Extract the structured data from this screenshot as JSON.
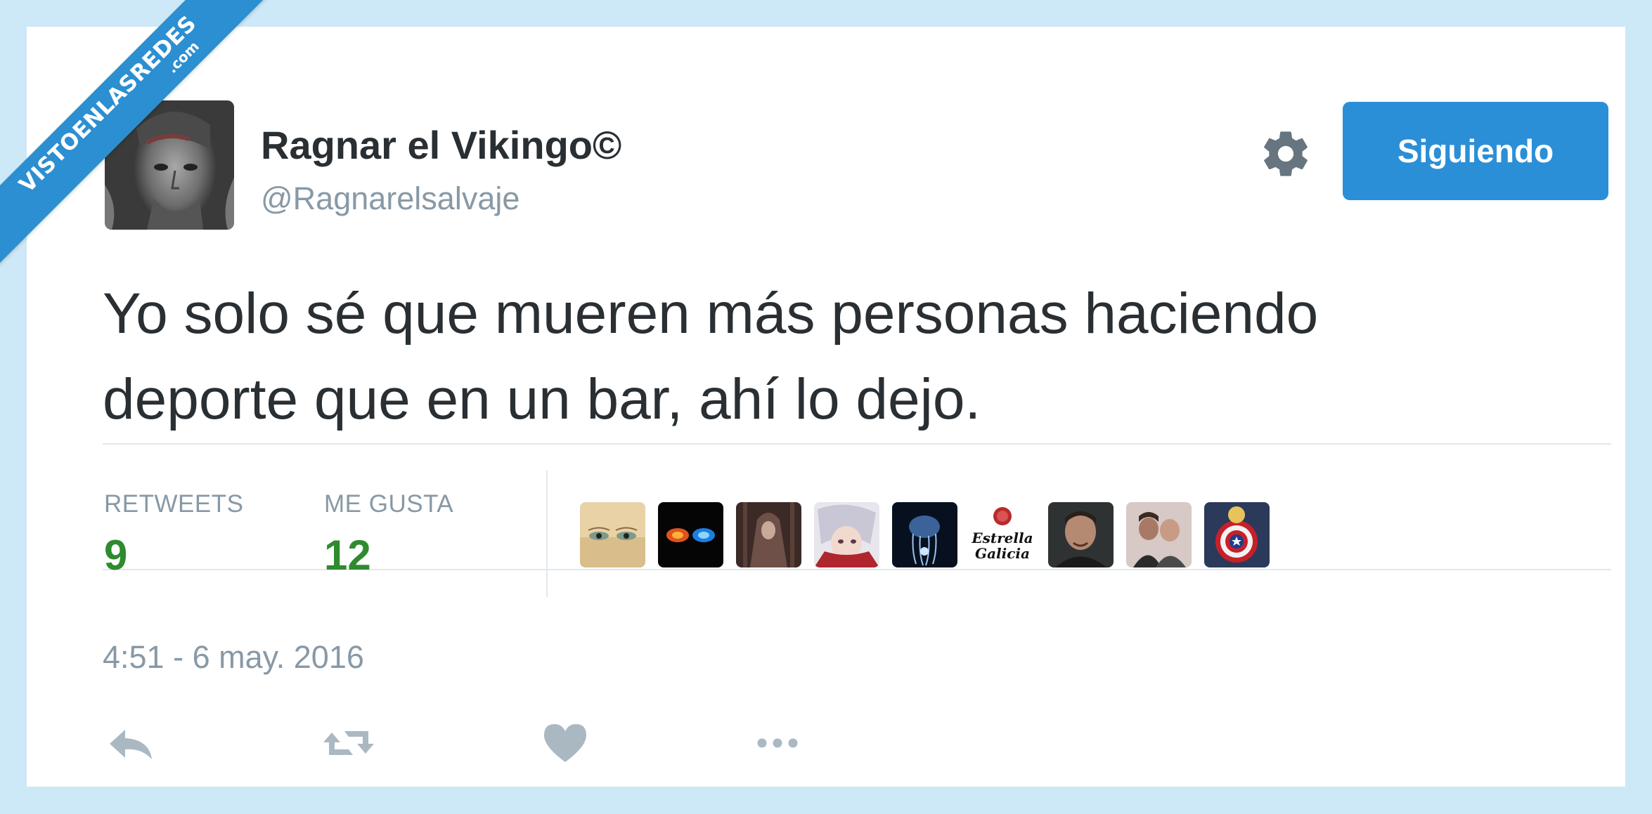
{
  "watermark": {
    "text": "VISTOENLASREDES",
    "sub": ".com"
  },
  "tweet": {
    "display_name": "Ragnar el Vikingo©",
    "handle": "@Ragnarelsalvaje",
    "follow_button": "Siguiendo",
    "text_lines": [
      "Yo solo sé que mueren más personas haciendo",
      "deporte que en un bar, ahí lo dejo."
    ],
    "stats": {
      "retweets_label": "RETWEETS",
      "retweets_value": "9",
      "likes_label": "ME GUSTA",
      "likes_value": "12"
    },
    "likers": [
      {
        "icon": "face-eyes-avatar"
      },
      {
        "icon": "fire-ice-avatar"
      },
      {
        "icon": "hooded-figure-avatar"
      },
      {
        "icon": "anime-character-avatar"
      },
      {
        "icon": "jellyfish-avatar"
      },
      {
        "icon": "estrella-galicia-avatar",
        "text_line1": "Estrella",
        "text_line2": "Galicia"
      },
      {
        "icon": "man-portrait-avatar"
      },
      {
        "icon": "couple-photo-avatar"
      },
      {
        "icon": "captain-america-shield-avatar"
      }
    ],
    "timestamp": "4:51 - 6 may. 2016",
    "actions": [
      "reply-icon",
      "retweet-icon",
      "like-icon",
      "more-icon"
    ]
  },
  "colors": {
    "background": "#cde8f6",
    "accent_blue": "#2b8fd8",
    "stat_green": "#2e8b2e",
    "text_dark": "#292f33",
    "text_gray": "#8899a6"
  }
}
